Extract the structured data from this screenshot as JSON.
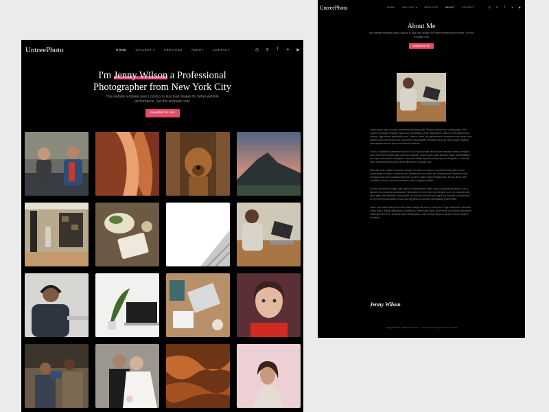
{
  "left": {
    "logo": "UntreePhoto",
    "nav": [
      "HOME",
      "GALLERY ▾",
      "SERVICES",
      "ABOUT",
      "CONTACT"
    ],
    "socials": [
      "◎",
      "⊙",
      "f",
      "✦",
      "▶"
    ],
    "hero": {
      "title_prefix": "I'm ",
      "title_name": "Jenny Wilson",
      "title_suffix": " a Professional",
      "title_line2": "Photographer from New York City",
      "subtitle": "This website template uses Lozad.js to lazy load images for better website performance. Get this template now!",
      "cta": "Available for Hire"
    }
  },
  "right": {
    "logo": "UntreePhoto",
    "nav": [
      "HOME",
      "GALLERY ▾",
      "SERVICES",
      "ABOUT",
      "CONTACT"
    ],
    "socials": [
      "◎",
      "⊙",
      "f",
      "✦",
      "▶"
    ],
    "title": "About Me",
    "subtitle": "This website template uses Lozad.js to lazy load images for better website performance. Get this template now!",
    "cta": "Available for Hire",
    "paragraphs": [
      "Lorem ipsum dolor sit amet, consectetur adipisicing elit. Tempora facere illum consequuntur. Sint corporis numquam magnam asperiores voluptatibus earum dignissimos. Maiores nobis quaerat sed dolorem fuga eveniet repellendus sunt. Tenetur, omnis nisi reprehenderit, laboriosam nam saepe, eum maiores optio minus fugit sunt consectetur. Recusandae molestias dolor sed officia magni, eligendi quas aperiam ab eos ipsum accusamus architecto.",
      "In ipsa, voluptatum praesentium dolore ut non repudiandae sit aut autem nesciunt ratione architecto cum perferendis veritatis quia a tempore aliquam, impedit quae quasi delectus magni necessitatibus. Ut neque accusantium voluptatem, esse velit debitis impedit nesciunt quasi consequatur. Commodi, nemo molestias rerum quam officiis distinctio in voluptas odio.",
      "Molestiae esse beatae obcaecati veritatis, eum libero et nostrum rem perferendis quam tenetur repudiandae ad ullam, et deleniti eum! Praesentium quo enim, est voluptas rerum blanditiis minus. Consequuntur dicta voluptatum aperiam, dolorem ipsam saepe! Repellendus, tenetur libero odio? Cupiditate, ipsum, vel esse accusamus officia magnam repellat.",
      "Ut enim ad minima veniam, quis nostrum exercitationem ullam corporis suscipit laboriosam, nisi ut aliquid ex ea commodi consequatur? Quis autem vel eum iure reprehenderit qui in ea voluptate velit esse quam nihil molestiae consequatur, vel illum qui dolorem eum fugiat quo voluptas nulla pariatur? At vero eos et accusamus et iusto odio dignissimos ducimus qui blanditiis praesentium.",
      "Totam, eum animi nihil perferendis veniam aliquid illo sunt a, omnis quis. Fugit consectetur reiciendis autem ipsum, itaque dignissimos voluptatibus, deleniti rem quasi, doloremque accusamus quibusdam minus aperiam error. Tempora ipsam debitis quam, modi, ad quia saepe in quaerat earum, adipisci architecto."
    ],
    "signature": "Jenny Wilson",
    "footer": "Copyright ©2021. All Rights Reserved. — Designed with love by Untree.co • License"
  },
  "gallery_tiles": [
    "photo-friends-laughing",
    "photo-desert-canyon",
    "photo-dog-in-doorway",
    "photo-mountain-sunset",
    "photo-modern-interior",
    "photo-food-flatlay",
    "photo-white-building",
    "photo-person-laptop-desk",
    "photo-man-headphones",
    "photo-plant-laptop",
    "photo-desk-overhead",
    "photo-woman-portrait",
    "photo-office-meeting",
    "photo-wedding-couple",
    "photo-abstract-rock",
    "photo-woman-pink-sky"
  ],
  "colors": {
    "accent": "#e44e6a",
    "background": "#000000",
    "page": "#ebebeb"
  }
}
